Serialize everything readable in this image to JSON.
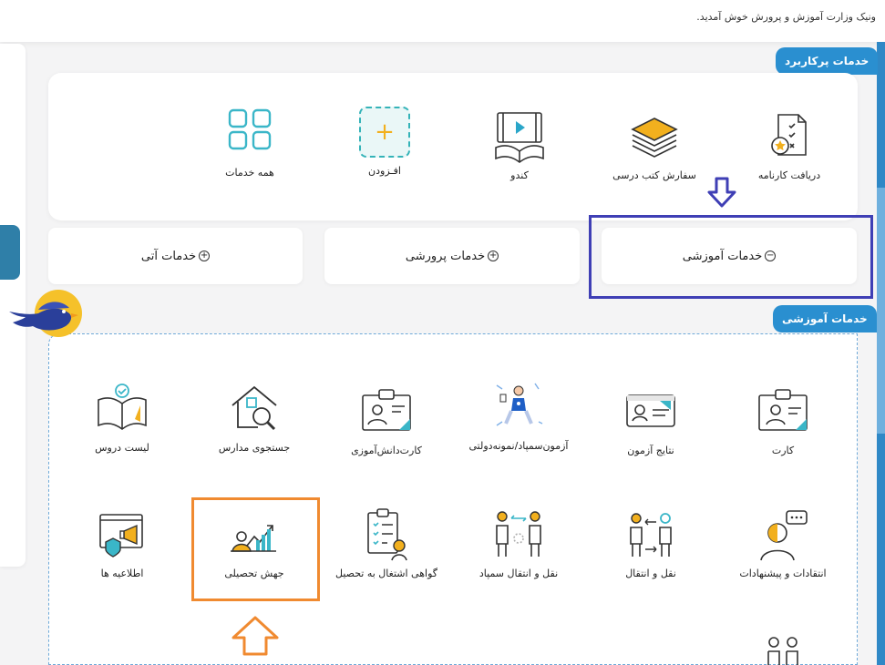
{
  "header": {
    "welcome_text": "ونیک وزارت آموزش و پرورش خوش آمدید."
  },
  "popular": {
    "title": "خدمات پرکاربرد",
    "items": [
      {
        "label": "دریافت کارنامه",
        "icon": "report-card-icon"
      },
      {
        "label": "سفارش کتب درسی",
        "icon": "textbook-order-icon"
      },
      {
        "label": "کندو",
        "icon": "video-book-icon"
      },
      {
        "label": "افـزودن",
        "icon": "add-icon",
        "symbol": "+"
      },
      {
        "label": "همه خدمات",
        "icon": "grid-icon"
      }
    ]
  },
  "categories": [
    {
      "label": "خدمات آتی",
      "symbol": "+"
    },
    {
      "label": "خدمات پرورشی",
      "symbol": "+"
    },
    {
      "label": "خدمات آموزشی",
      "symbol": "−"
    }
  ],
  "education": {
    "title": "خدمات آموزشی",
    "items": [
      {
        "label": "کارت",
        "icon": "id-badge-icon"
      },
      {
        "label": "نتایج آزمون",
        "icon": "id-card-icon"
      },
      {
        "label": "آزمون‌سمپاد/نمونه‌دولتی",
        "icon": "flying-student-icon"
      },
      {
        "label": "کارت‌دانش‌آموزی",
        "icon": "student-card-icon"
      },
      {
        "label": "جستجوی مدارس",
        "icon": "school-search-icon"
      },
      {
        "label": "لیست دروس",
        "icon": "open-book-check-icon"
      },
      {
        "label": "انتقادات و پیشنهادات",
        "icon": "feedback-person-icon"
      },
      {
        "label": "نقل و انتقال",
        "icon": "transfer-icon"
      },
      {
        "label": "نقل و انتقال سمپاد",
        "icon": "transfer-sampad-icon"
      },
      {
        "label": "گواهی اشتغال به تحصیل",
        "icon": "certificate-icon"
      },
      {
        "label": "جهش تحصیلی",
        "icon": "growth-chart-icon"
      },
      {
        "label": "اطلاعیه ها",
        "icon": "announcement-icon"
      }
    ]
  },
  "colors": {
    "accent": "#2a8fd0",
    "highlight_blue": "#3f3fb5",
    "highlight_orange": "#f08a30"
  }
}
